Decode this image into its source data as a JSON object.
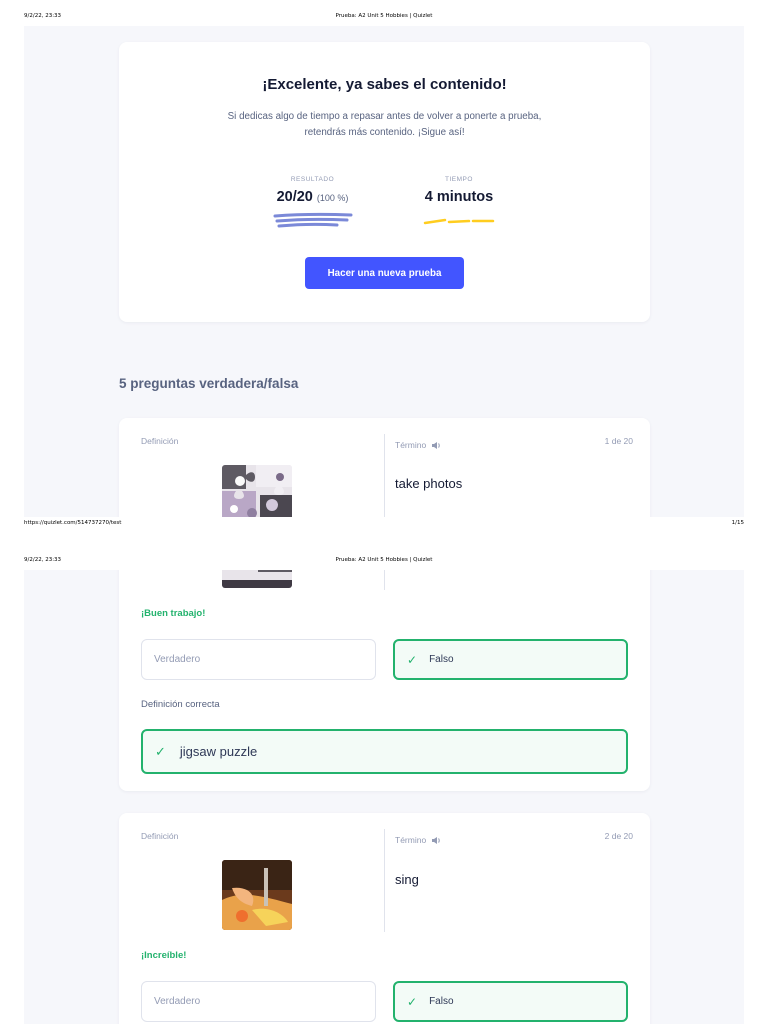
{
  "print": {
    "date": "9/2/22, 23:33",
    "doc_title": "Prueba: A2 Unit 5 Hobbies | Quizlet",
    "url": "https://quizlet.com/514737270/test",
    "page_count": "1/15"
  },
  "result": {
    "title": "¡Excelente, ya sabes el contenido!",
    "subtitle": "Si dedicas algo de tiempo a repasar antes de volver a ponerte a prueba, retendrás más contenido. ¡Sigue así!",
    "score_label": "RESULTADO",
    "score_value": "20/20",
    "score_percent": "(100 %)",
    "time_label": "TIEMPO",
    "time_value": "4 minutos",
    "new_test_button": "Hacer una nueva prueba",
    "accent_color": "#4255ff",
    "score_squiggle_color": "#7b89d8",
    "time_squiggle_color": "#ffcd1f"
  },
  "section_title": "5 preguntas verdadera/falsa",
  "questions": [
    {
      "definition_label": "Definición",
      "term_label": "Término",
      "counter": "1 de 20",
      "term": "take photos",
      "image": "jigsaw-puzzle-photo",
      "feedback": "¡Buen trabajo!",
      "option_true": "Verdadero",
      "option_false": "Falso",
      "correct_definition_label": "Definición correcta",
      "correct_definition": "jigsaw puzzle"
    },
    {
      "definition_label": "Definición",
      "term_label": "Término",
      "counter": "2 de 20",
      "term": "sing",
      "image": "sewing-photo",
      "feedback": "¡Increíble!",
      "option_true": "Verdadero",
      "option_false": "Falso"
    }
  ],
  "colors": {
    "success": "#23b26d",
    "background": "#f6f7fb"
  }
}
